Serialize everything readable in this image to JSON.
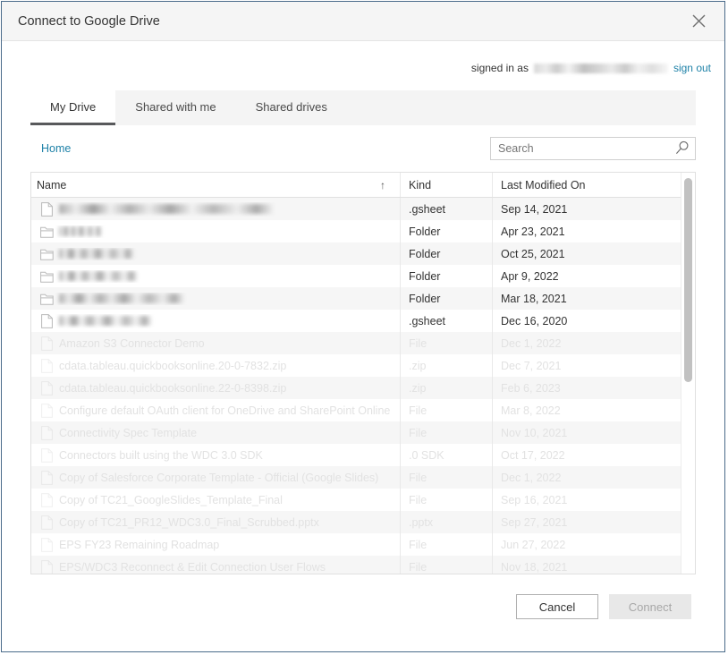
{
  "dialog": {
    "title": "Connect to Google Drive",
    "close_icon": "close-icon"
  },
  "account": {
    "signed_in_label": "signed in as",
    "email_redacted": true,
    "sign_out_label": "sign out"
  },
  "tabs": [
    {
      "label": "My Drive",
      "active": true
    },
    {
      "label": "Shared with me",
      "active": false
    },
    {
      "label": "Shared drives",
      "active": false
    }
  ],
  "breadcrumb": {
    "label": "Home"
  },
  "search": {
    "value": "",
    "placeholder": "Search",
    "icon": "search-icon"
  },
  "table": {
    "columns": [
      "Name",
      "Kind",
      "Last Modified On"
    ],
    "sort": {
      "column": "Name",
      "direction": "asc",
      "glyph": "↑"
    },
    "rows": [
      {
        "name": "",
        "redacted": true,
        "redact_width": 240,
        "icon": "file-icon",
        "kind": ".gsheet",
        "modified": "Sep 14, 2021",
        "faded": false
      },
      {
        "name": "",
        "redacted": true,
        "redact_width": 48,
        "icon": "folder-icon",
        "kind": "Folder",
        "modified": "Apr 23, 2021",
        "faded": false
      },
      {
        "name": "",
        "redacted": true,
        "redact_width": 84,
        "icon": "folder-icon",
        "kind": "Folder",
        "modified": "Oct 25, 2021",
        "faded": false
      },
      {
        "name": "",
        "redacted": true,
        "redact_width": 88,
        "icon": "folder-icon",
        "kind": "Folder",
        "modified": "Apr 9, 2022",
        "faded": false
      },
      {
        "name": "",
        "redacted": true,
        "redact_width": 140,
        "icon": "folder-icon",
        "kind": "Folder",
        "modified": "Mar 18, 2021",
        "faded": false
      },
      {
        "name": "",
        "redacted": true,
        "redact_width": 104,
        "icon": "file-icon",
        "kind": ".gsheet",
        "modified": "Dec 16, 2020",
        "faded": false
      },
      {
        "name": "Amazon S3 Connector Demo",
        "redacted": false,
        "icon": "file-icon",
        "kind": "File",
        "modified": "Dec 1, 2022",
        "faded": true
      },
      {
        "name": "cdata.tableau.quickbooksonline.20-0-7832.zip",
        "redacted": false,
        "icon": "file-icon",
        "kind": ".zip",
        "modified": "Dec 7, 2021",
        "faded": true
      },
      {
        "name": "cdata.tableau.quickbooksonline.22-0-8398.zip",
        "redacted": false,
        "icon": "file-icon",
        "kind": ".zip",
        "modified": "Feb 6, 2023",
        "faded": true
      },
      {
        "name": "Configure default OAuth client for OneDrive and SharePoint Online",
        "redacted": false,
        "icon": "file-icon",
        "kind": "File",
        "modified": "Mar 8, 2022",
        "faded": true
      },
      {
        "name": "Connectivity Spec Template",
        "redacted": false,
        "icon": "file-icon",
        "kind": "File",
        "modified": "Nov 10, 2021",
        "faded": true
      },
      {
        "name": "Connectors built using the WDC 3.0 SDK",
        "redacted": false,
        "icon": "file-icon",
        "kind": ".0 SDK",
        "modified": "Oct 17, 2022",
        "faded": true
      },
      {
        "name": "Copy of Salesforce Corporate Template - Official (Google Slides)",
        "redacted": false,
        "icon": "file-icon",
        "kind": "File",
        "modified": "Dec 1, 2022",
        "faded": true
      },
      {
        "name": "Copy of TC21_GoogleSlides_Template_Final",
        "redacted": false,
        "icon": "file-icon",
        "kind": "File",
        "modified": "Sep 16, 2021",
        "faded": true
      },
      {
        "name": "Copy of TC21_PR12_WDC3.0_Final_Scrubbed.pptx",
        "redacted": false,
        "icon": "file-icon",
        "kind": ".pptx",
        "modified": "Sep 27, 2021",
        "faded": true
      },
      {
        "name": "EPS FY23 Remaining Roadmap",
        "redacted": false,
        "icon": "file-icon",
        "kind": "File",
        "modified": "Jun 27, 2022",
        "faded": true
      },
      {
        "name": "EPS/WDC3 Reconnect & Edit Connection User Flows",
        "redacted": false,
        "icon": "file-icon",
        "kind": "File",
        "modified": "Nov 18, 2021",
        "faded": true
      }
    ]
  },
  "footer": {
    "cancel_label": "Cancel",
    "connect_label": "Connect",
    "connect_disabled": true
  },
  "colors": {
    "link": "#1f82a8",
    "dialog_border": "#4a6b8a",
    "active_tab_underline": "#58595b",
    "row_stripe": "#f6f6f6",
    "faded_text": "#e2e2e2"
  }
}
